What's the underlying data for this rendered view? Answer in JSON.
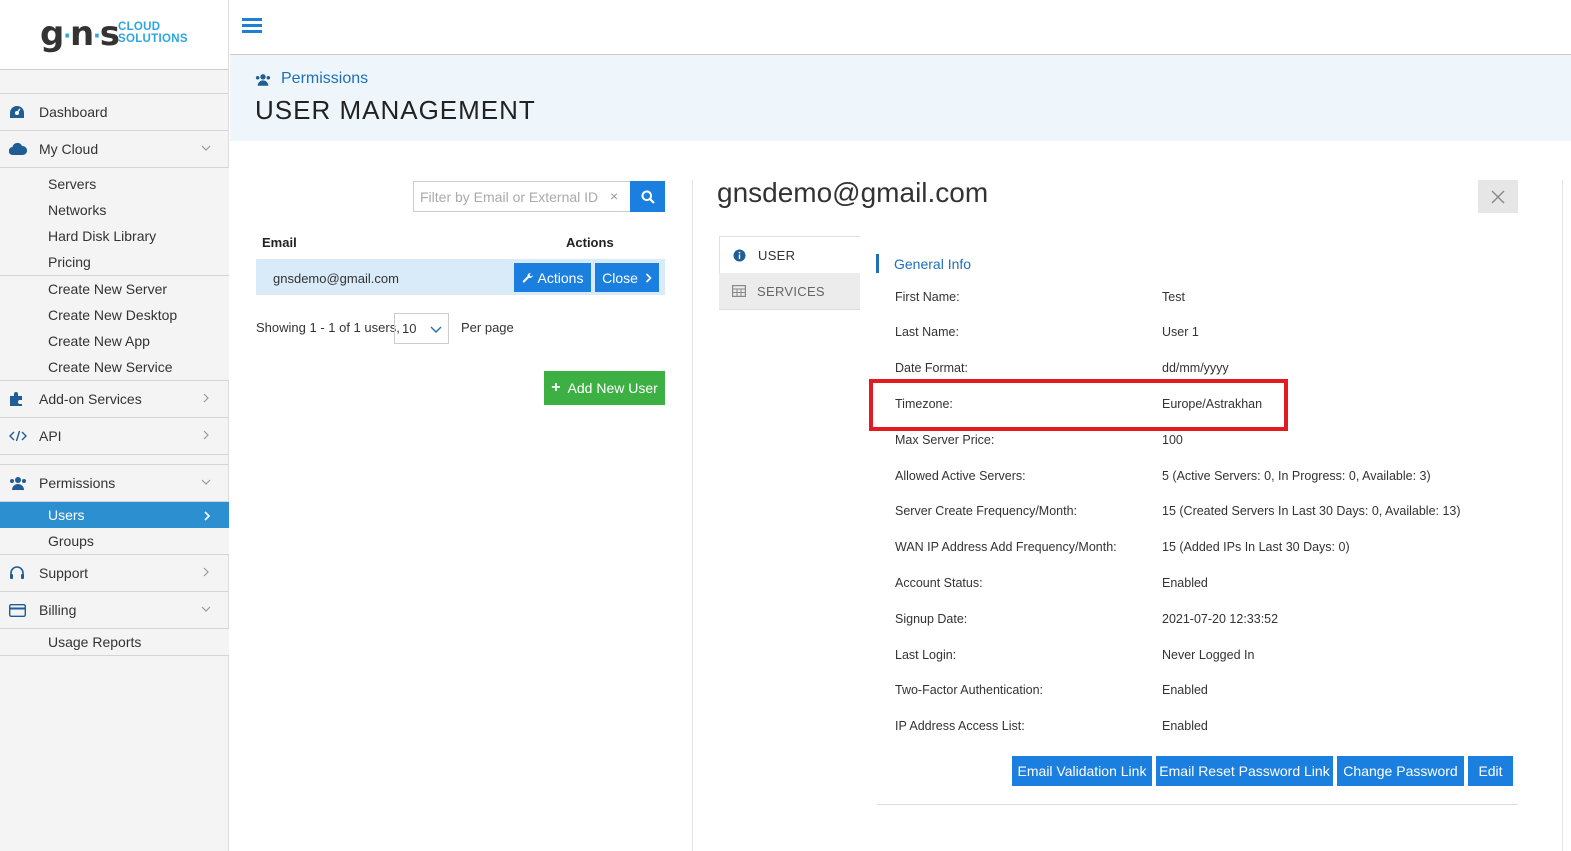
{
  "brand": {
    "logo_mark": "gns",
    "logo_line1": "CLOUD",
    "logo_line2": "SOLUTIONS"
  },
  "sidebar": {
    "dashboard": "Dashboard",
    "my_cloud": "My Cloud",
    "my_cloud_items": [
      "Servers",
      "Networks",
      "Hard Disk Library",
      "Pricing"
    ],
    "create_items": [
      "Create New Server",
      "Create New Desktop",
      "Create New App",
      "Create New Service"
    ],
    "addon": "Add-on Services",
    "api": "API",
    "permissions": "Permissions",
    "permissions_items": [
      "Users",
      "Groups"
    ],
    "support": "Support",
    "billing": "Billing",
    "billing_items": [
      "Usage Reports"
    ]
  },
  "header": {
    "breadcrumb": "Permissions",
    "title": "USER MANAGEMENT"
  },
  "user_list": {
    "filter_placeholder": "Filter by Email or External ID",
    "clear_symbol": "×",
    "col_email": "Email",
    "col_actions": "Actions",
    "rows": [
      {
        "email": "gnsdemo@gmail.com"
      }
    ],
    "actions_label": "Actions",
    "close_label": "Close",
    "showing": "Showing 1 - 1 of 1 users,",
    "per_page_value": "10",
    "per_page_label": "Per page",
    "add_user": "Add New User"
  },
  "detail": {
    "email": "gnsdemo@gmail.com",
    "tabs": [
      "USER",
      "SERVICES"
    ],
    "section": "General Info",
    "fields": [
      {
        "label": "First Name:",
        "value": "Test"
      },
      {
        "label": "Last Name:",
        "value": "User 1"
      },
      {
        "label": "Date Format:",
        "value": "dd/mm/yyyy"
      },
      {
        "label": "Timezone:",
        "value": "Europe/Astrakhan"
      },
      {
        "label": "Max Server Price:",
        "value": "100"
      },
      {
        "label": "Allowed Active Servers:",
        "value": "5 (Active Servers: 0, In Progress: 0, Available: 3)"
      },
      {
        "label": "Server Create Frequency/Month:",
        "value": "15 (Created Servers In Last 30 Days: 0, Available: 13)"
      },
      {
        "label": "WAN IP Address Add Frequency/Month:",
        "value": "15 (Added IPs In Last 30 Days: 0)"
      },
      {
        "label": "Account Status:",
        "value": "Enabled"
      },
      {
        "label": "Signup Date:",
        "value": "2021-07-20 12:33:52"
      },
      {
        "label": "Last Login:",
        "value": "Never Logged In"
      },
      {
        "label": "Two-Factor Authentication:",
        "value": "Enabled"
      },
      {
        "label": "IP Address Access List:",
        "value": "Enabled"
      }
    ],
    "buttons": {
      "email_validation": "Email Validation Link",
      "email_reset": "Email Reset Password Link",
      "change_password": "Change Password",
      "edit": "Edit"
    }
  },
  "colors": {
    "accent": "#1b7fe0",
    "active_nav": "#2b8fd0",
    "success": "#3cb043",
    "highlight": "#e21b23",
    "header_bg": "#eef6fb"
  }
}
